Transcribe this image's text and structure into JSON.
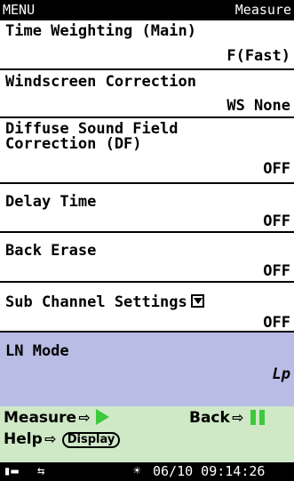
{
  "header": {
    "left": "MENU",
    "right": "Measure"
  },
  "items": [
    {
      "label": "Time Weighting (Main)",
      "value": "F(Fast)"
    },
    {
      "label": "Windscreen Correction",
      "value": "WS None"
    },
    {
      "label": "Diffuse Sound Field\nCorrection (DF)",
      "value": "OFF"
    },
    {
      "label": "Delay Time",
      "value": "OFF"
    },
    {
      "label": "Back Erase",
      "value": "OFF"
    },
    {
      "label": "Sub Channel Settings",
      "value": "OFF"
    },
    {
      "label": "LN Mode",
      "value": "Lp"
    }
  ],
  "footer": {
    "measure": "Measure",
    "back": "Back",
    "help": "Help",
    "display_key": "Display",
    "arrow": "⇨"
  },
  "status": {
    "datetime": "06/10 09:14:26",
    "icons": [
      "battery-plug-icon",
      "usb-link-icon",
      "sun-brightness-icon"
    ]
  },
  "colors": {
    "selected": "#b9bce4",
    "footer": "#cfe8c6",
    "accent": "#3cc93c"
  }
}
